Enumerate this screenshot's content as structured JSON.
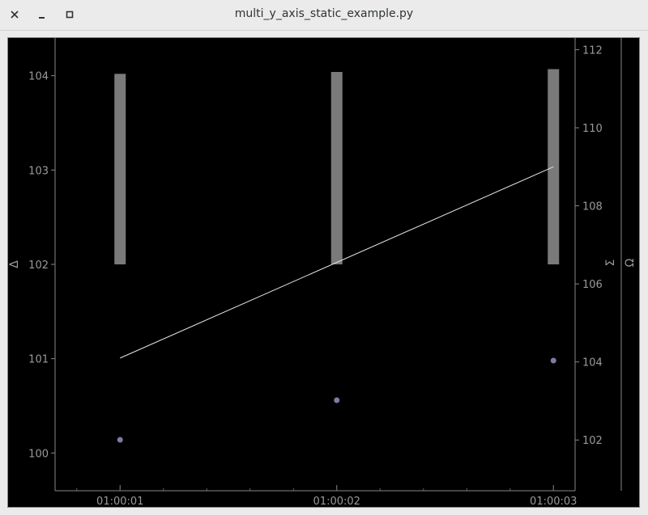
{
  "window": {
    "title": "multi_y_axis_static_example.py",
    "close_icon": "close-icon",
    "minimize_icon": "minimize-icon",
    "maximize_icon": "maximize-icon"
  },
  "chart_data": {
    "type": "line",
    "title": "",
    "x": {
      "ticks": [
        "01:00:01",
        "01:00:02",
        "01:00:03"
      ],
      "range": [
        0.7,
        3.1
      ]
    },
    "axes": {
      "left": {
        "label": "Δ",
        "range": [
          99.6,
          104.4
        ],
        "ticks": [
          100,
          101,
          102,
          103,
          104
        ]
      },
      "right1": {
        "label": "Σ",
        "range": [
          100.7,
          112.3
        ],
        "ticks": [
          102,
          104,
          106,
          108,
          110,
          112
        ]
      },
      "right2": {
        "label": "Ω",
        "range": [
          0,
          1
        ],
        "ticks": []
      }
    },
    "series": [
      {
        "type": "bar",
        "axis": "left",
        "x": [
          1,
          2,
          3
        ],
        "base": 102,
        "values": [
          104.02,
          104.04,
          104.07
        ],
        "color": "#7a7a7a"
      },
      {
        "type": "line",
        "axis": "right1",
        "x": [
          1,
          3
        ],
        "values": [
          104.1,
          109.0
        ],
        "color": "#e6e6e6"
      },
      {
        "type": "scatter",
        "axis": "left",
        "x": [
          1,
          2,
          3
        ],
        "values": [
          100.14,
          100.56,
          100.98
        ],
        "color": "#7f7aa6"
      }
    ],
    "grid": false
  }
}
